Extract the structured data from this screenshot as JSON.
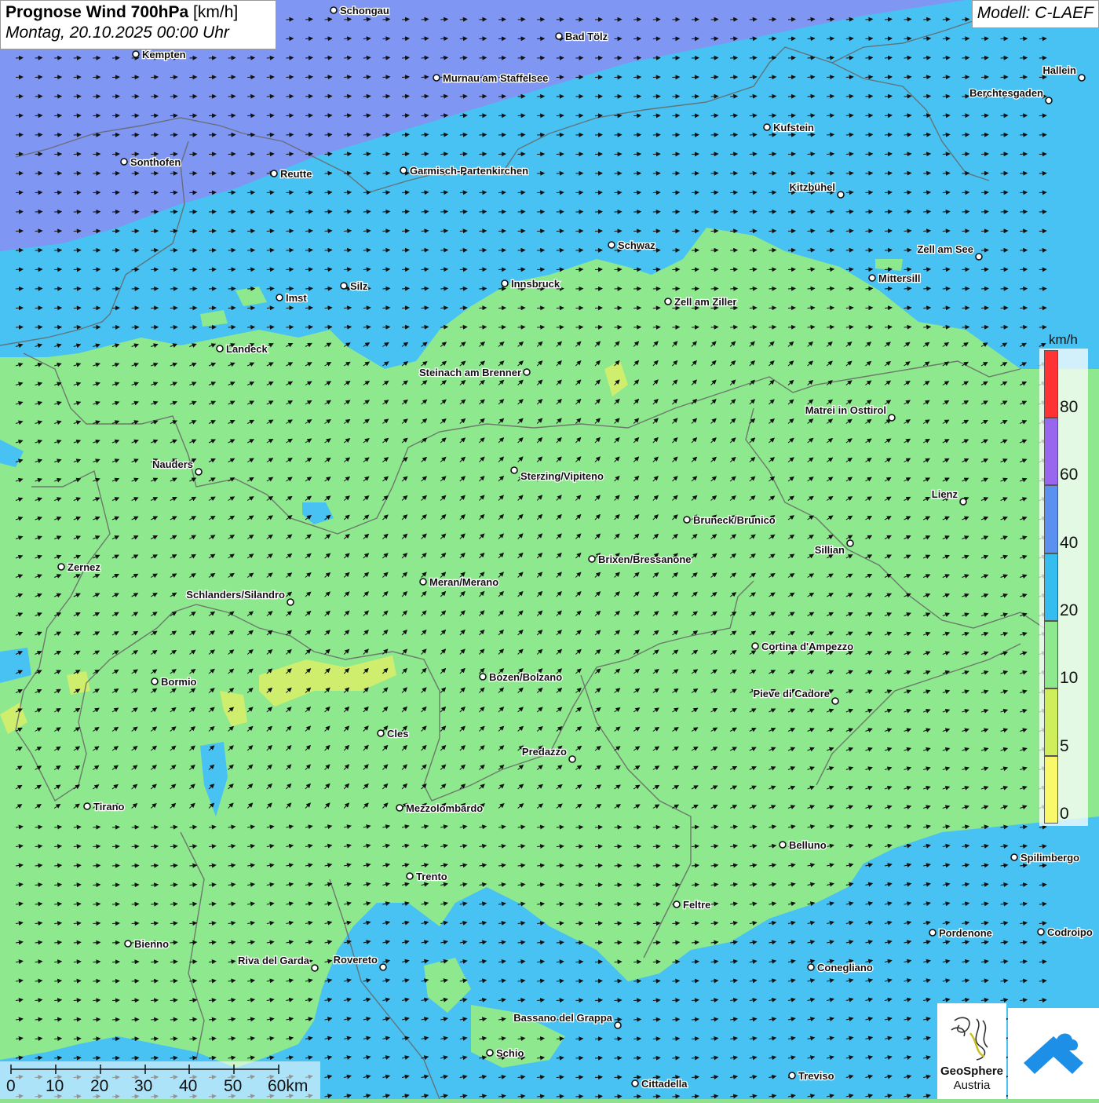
{
  "title": {
    "main": "Prognose Wind 700hPa",
    "unit": "[km/h]",
    "datetime": "Montag, 20.10.2025 00:00 Uhr"
  },
  "model": "Modell: C-LAEF",
  "legend": {
    "unit": "km/h",
    "labels": [
      "80",
      "60",
      "40",
      "20",
      "10",
      "5",
      "0"
    ],
    "colors": [
      "#ff3333",
      "#9966ee",
      "#5b8ff0",
      "#36bdf0",
      "#8ee88e",
      "#cfee5c",
      "#f8f86a"
    ]
  },
  "scale_bar": {
    "labels": [
      "0",
      "10",
      "20",
      "30",
      "40",
      "50",
      "60km"
    ]
  },
  "logo": {
    "line1": "GeoSphere",
    "line2": "Austria"
  },
  "wind_colors": {
    "band_60_80": "#7f97f2",
    "band_20_40": "#48c2f2",
    "band_10_20": "#8ee88e",
    "band_5_10": "#d6ee6a"
  },
  "places": [
    {
      "name": "Schongau"
    },
    {
      "name": "Bad Tölz"
    },
    {
      "name": "Kempten"
    },
    {
      "name": "Murnau am Staffelsee"
    },
    {
      "name": "Hallein"
    },
    {
      "name": "Berchtesgaden"
    },
    {
      "name": "Kufstein"
    },
    {
      "name": "Sonthofen"
    },
    {
      "name": "Reutte"
    },
    {
      "name": "Garmisch-Partenkirchen"
    },
    {
      "name": "Kitzbühel"
    },
    {
      "name": "Schwaz"
    },
    {
      "name": "Zell am See"
    },
    {
      "name": "Mittersill"
    },
    {
      "name": "Innsbruck"
    },
    {
      "name": "Silz"
    },
    {
      "name": "Imst"
    },
    {
      "name": "Zell am Ziller"
    },
    {
      "name": "Landeck"
    },
    {
      "name": "Steinach am Brenner"
    },
    {
      "name": "Matrei in Osttirol"
    },
    {
      "name": "Nauders"
    },
    {
      "name": "Sterzing/Vipiteno"
    },
    {
      "name": "Lienz"
    },
    {
      "name": "Bruneck/Brunico"
    },
    {
      "name": "Sillian"
    },
    {
      "name": "Brixen/Bressanone"
    },
    {
      "name": "Zernez"
    },
    {
      "name": "Meran/Merano"
    },
    {
      "name": "Schlanders/Silandro"
    },
    {
      "name": "Cortina d'Ampezzo"
    },
    {
      "name": "Bozen/Bolzano"
    },
    {
      "name": "Bormio"
    },
    {
      "name": "Pieve di Cadore"
    },
    {
      "name": "Cles"
    },
    {
      "name": "Predazzo"
    },
    {
      "name": "Tirano"
    },
    {
      "name": "Mezzolombardo"
    },
    {
      "name": "Belluno"
    },
    {
      "name": "Spilimbergo"
    },
    {
      "name": "Trento"
    },
    {
      "name": "Feltre"
    },
    {
      "name": "Bienno"
    },
    {
      "name": "Pordenone"
    },
    {
      "name": "Codroipo"
    },
    {
      "name": "Riva del Garda"
    },
    {
      "name": "Rovereto"
    },
    {
      "name": "Conegliano"
    },
    {
      "name": "Bassano del Grappa"
    },
    {
      "name": "Schio"
    },
    {
      "name": "Treviso"
    },
    {
      "name": "Cittadella"
    }
  ]
}
